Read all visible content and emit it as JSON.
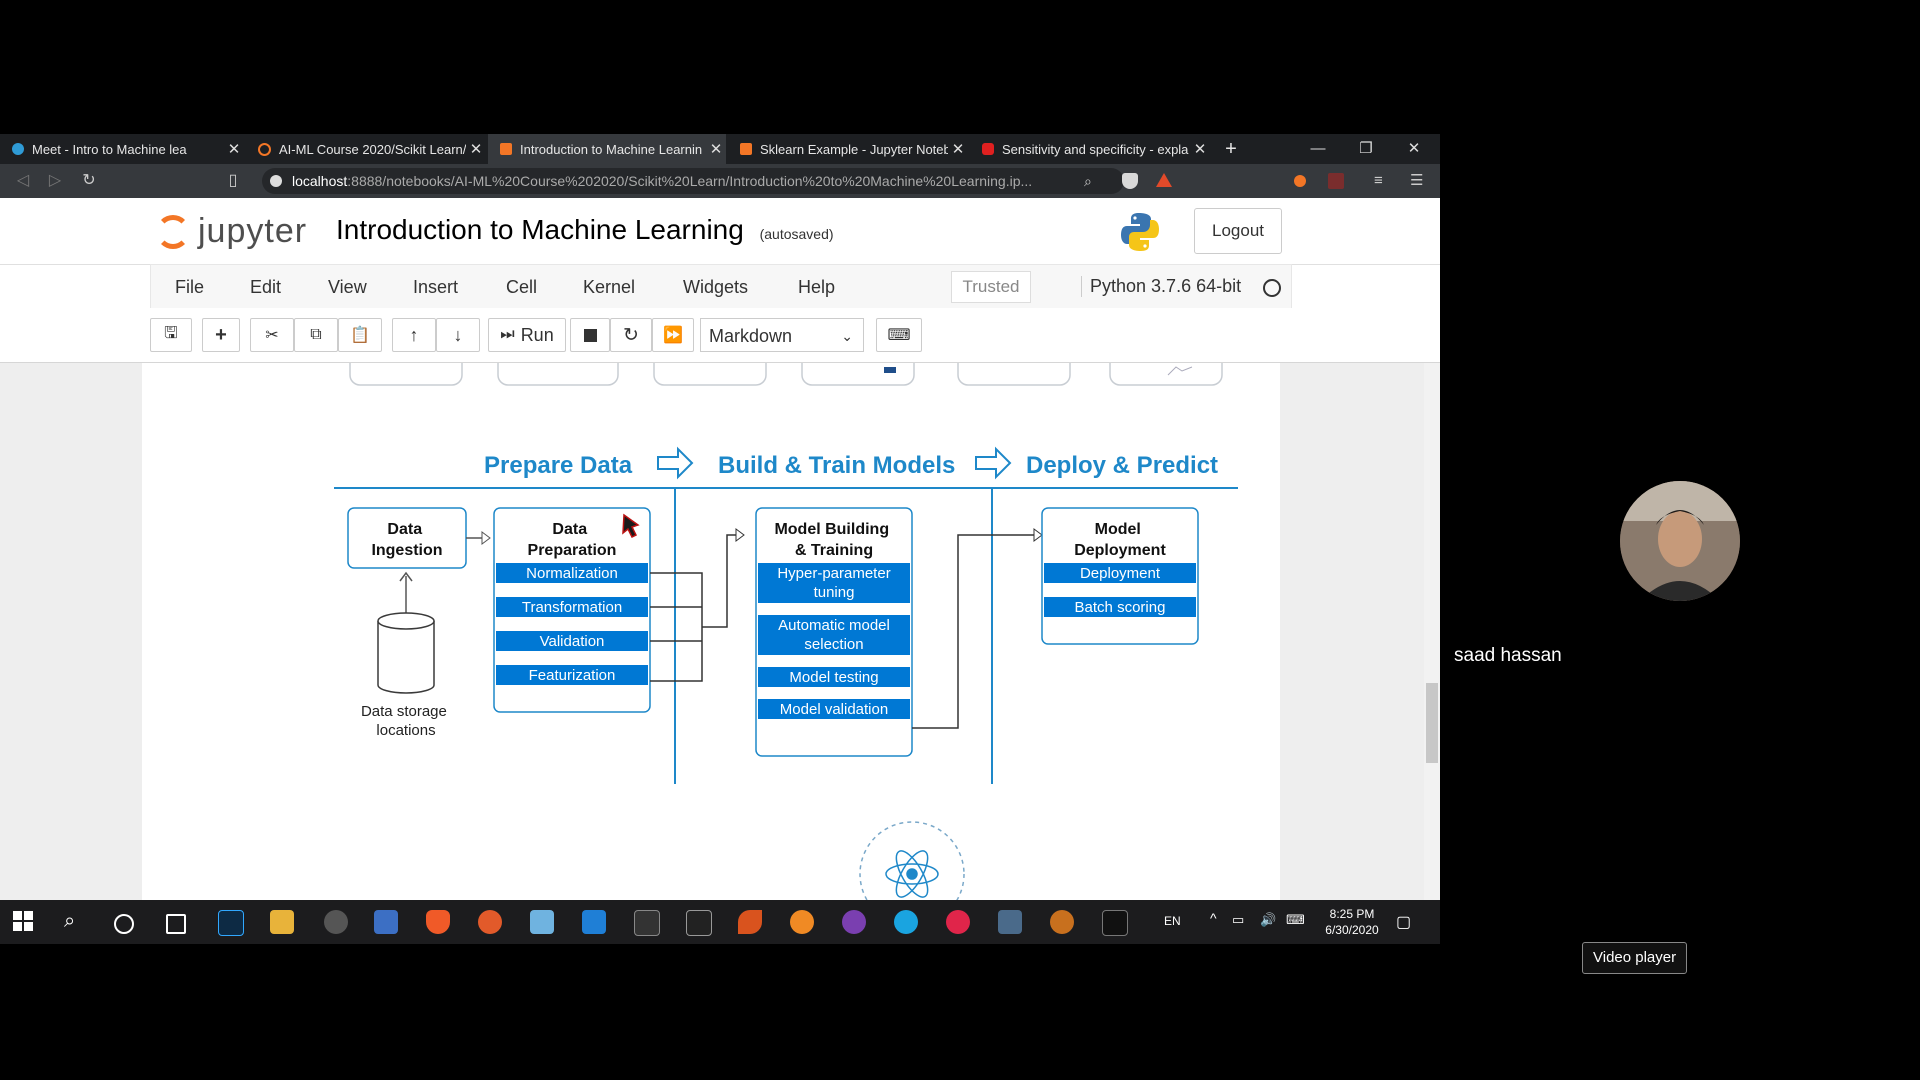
{
  "browser": {
    "tabs": [
      {
        "title": "Meet - Intro to Machine lea",
        "color": "#2f9bd6",
        "active": false
      },
      {
        "title": "AI-ML Course 2020/Scikit Learn/",
        "color": "#f37626",
        "active": false
      },
      {
        "title": "Introduction to Machine Learnin",
        "color": "#f37626",
        "active": true
      },
      {
        "title": "Sklearn Example - Jupyter Noteb",
        "color": "#f37626",
        "active": false
      },
      {
        "title": "Sensitivity and specificity - expla",
        "color": "#e02020",
        "active": false
      }
    ],
    "new_tab": "+",
    "url_host": "localhost",
    "url_path": ":8888/notebooks/AI-ML%20Course%202020/Scikit%20Learn/Introduction%20to%20Machine%20Learning.ip..."
  },
  "jupyter": {
    "logo_text": "jupyter",
    "notebook_title": "Introduction to Machine Learning",
    "autosave": "(autosaved)",
    "logout": "Logout",
    "menus": [
      "File",
      "Edit",
      "View",
      "Insert",
      "Cell",
      "Kernel",
      "Widgets",
      "Help"
    ],
    "trusted": "Trusted",
    "kernel": "Python 3.7.6 64-bit",
    "run_label": "Run",
    "cell_type": "Markdown"
  },
  "diagram": {
    "stages": [
      "Prepare Data",
      "Build & Train Models",
      "Deploy & Predict"
    ],
    "ingestion": "Data\nIngestion",
    "storage": "Data storage\nlocations",
    "prep_title": "Data\nPreparation",
    "prep_items": [
      "Normalization",
      "Transformation",
      "Validation",
      "Featurization"
    ],
    "model_title": "Model Building\n& Training",
    "model_items": [
      "Hyper-parameter\ntuning",
      "Automatic model\nselection",
      "Model testing",
      "Model validation"
    ],
    "deploy_title": "Model\nDeployment",
    "deploy_items": [
      "Deployment",
      "Batch scoring"
    ]
  },
  "taskbar": {
    "lang": "EN",
    "time": "8:25 PM",
    "date": "6/30/2020"
  },
  "participant": {
    "name": "saad hassan"
  },
  "video_player": "Video player",
  "colors": {
    "accent": "#0078d4",
    "stage_title": "#1e88c9",
    "jupyter_orange": "#f37626"
  }
}
